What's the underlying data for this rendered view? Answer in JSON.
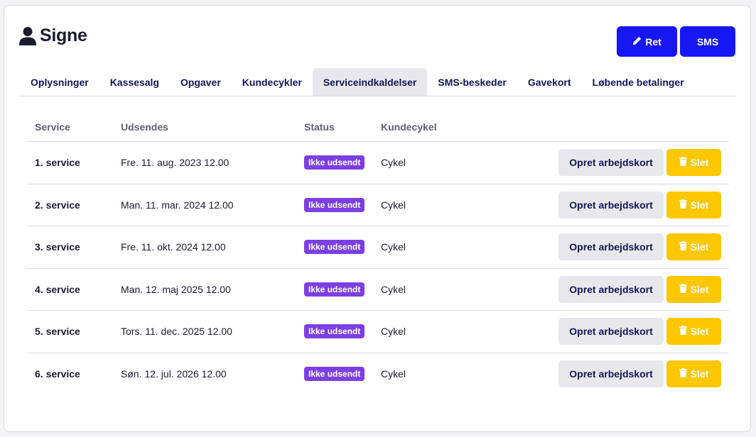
{
  "header": {
    "title": "Signe",
    "icon": "user-icon",
    "edit_label": "Ret",
    "edit_icon": "pencil-icon",
    "sms_label": "SMS"
  },
  "colors": {
    "primary": "#1717f5",
    "badge": "#7b3fe4",
    "delete": "#ffc700",
    "tab_active_bg": "#e8e8ec"
  },
  "tabs": [
    {
      "label": "Oplysninger",
      "active": false
    },
    {
      "label": "Kassesalg",
      "active": false
    },
    {
      "label": "Opgaver",
      "active": false
    },
    {
      "label": "Kundecykler",
      "active": false
    },
    {
      "label": "Serviceindkaldelser",
      "active": true
    },
    {
      "label": "SMS-beskeder",
      "active": false
    },
    {
      "label": "Gavekort",
      "active": false
    },
    {
      "label": "Løbende betalinger",
      "active": false
    }
  ],
  "table": {
    "columns": [
      "Service",
      "Udsendes",
      "Status",
      "Kundecykel",
      ""
    ],
    "create_label": "Opret arbejdskort",
    "delete_label": "Slet",
    "delete_icon": "trash-icon",
    "rows": [
      {
        "service": "1. service",
        "date": "Fre. 11. aug. 2023 12.00",
        "status": "Ikke udsendt",
        "bike": "Cykel"
      },
      {
        "service": "2. service",
        "date": "Man. 11. mar. 2024 12.00",
        "status": "Ikke udsendt",
        "bike": "Cykel"
      },
      {
        "service": "3. service",
        "date": "Fre. 11. okt. 2024 12.00",
        "status": "Ikke udsendt",
        "bike": "Cykel"
      },
      {
        "service": "4. service",
        "date": "Man. 12. maj 2025 12.00",
        "status": "Ikke udsendt",
        "bike": "Cykel"
      },
      {
        "service": "5. service",
        "date": "Tors. 11. dec. 2025 12.00",
        "status": "Ikke udsendt",
        "bike": "Cykel"
      },
      {
        "service": "6. service",
        "date": "Søn. 12. jul. 2026 12.00",
        "status": "Ikke udsendt",
        "bike": "Cykel"
      }
    ]
  }
}
